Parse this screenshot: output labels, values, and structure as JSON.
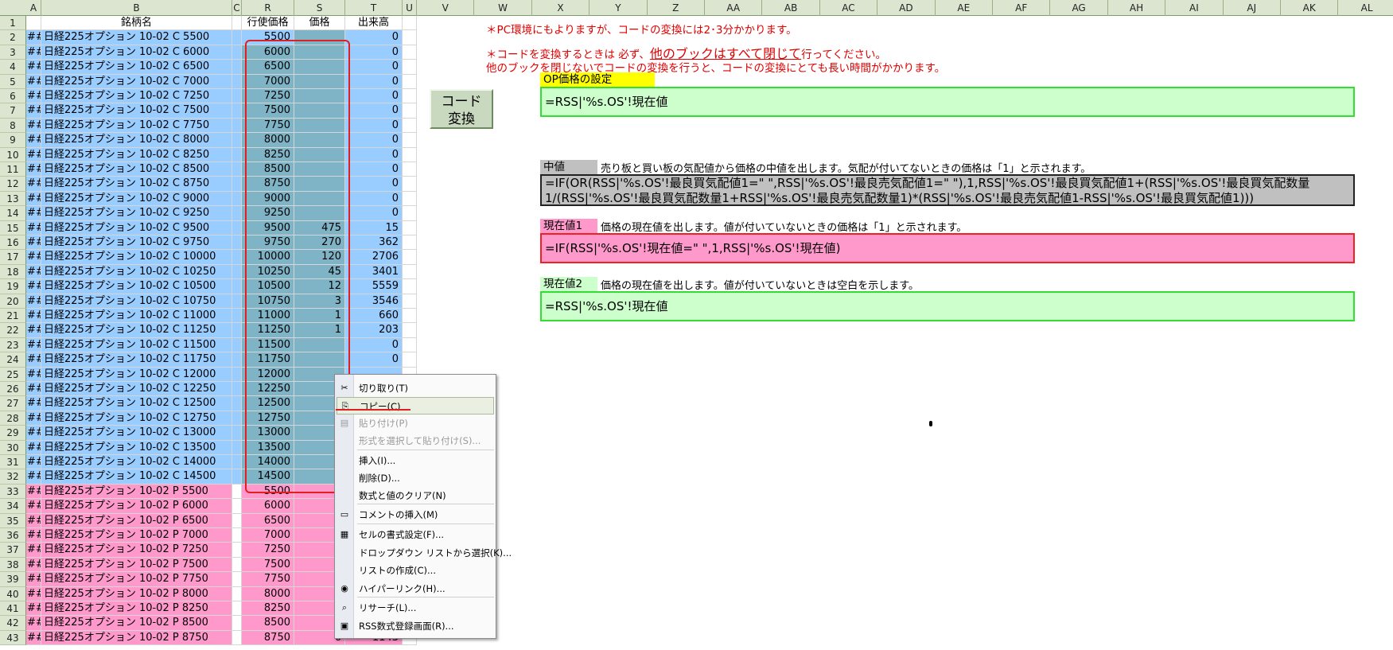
{
  "columns": [
    "A",
    "B",
    "C",
    "R",
    "S",
    "T",
    "U",
    "V",
    "W",
    "X",
    "Y",
    "Z",
    "AA",
    "AB",
    "AC",
    "AD",
    "AE",
    "AF",
    "AG",
    "AH",
    "AI",
    "AJ",
    "AK",
    "AL"
  ],
  "headers": {
    "a": "",
    "name": "銘柄名",
    "strike": "行使価格",
    "price": "価格",
    "volume": "出来高"
  },
  "rows": [
    {
      "a": "##",
      "name": "日経225オプション 10-02 C 5500",
      "strike": "5500",
      "price": "",
      "volume": "0"
    },
    {
      "a": "##",
      "name": "日経225オプション 10-02 C 6000",
      "strike": "6000",
      "price": "",
      "volume": "0"
    },
    {
      "a": "##",
      "name": "日経225オプション 10-02 C 6500",
      "strike": "6500",
      "price": "",
      "volume": "0"
    },
    {
      "a": "##",
      "name": "日経225オプション 10-02 C 7000",
      "strike": "7000",
      "price": "",
      "volume": "0"
    },
    {
      "a": "##",
      "name": "日経225オプション 10-02 C 7250",
      "strike": "7250",
      "price": "",
      "volume": "0"
    },
    {
      "a": "##",
      "name": "日経225オプション 10-02 C 7500",
      "strike": "7500",
      "price": "",
      "volume": "0"
    },
    {
      "a": "##",
      "name": "日経225オプション 10-02 C 7750",
      "strike": "7750",
      "price": "",
      "volume": "0"
    },
    {
      "a": "##",
      "name": "日経225オプション 10-02 C 8000",
      "strike": "8000",
      "price": "",
      "volume": "0"
    },
    {
      "a": "##",
      "name": "日経225オプション 10-02 C 8250",
      "strike": "8250",
      "price": "",
      "volume": "0"
    },
    {
      "a": "##",
      "name": "日経225オプション 10-02 C 8500",
      "strike": "8500",
      "price": "",
      "volume": "0"
    },
    {
      "a": "##",
      "name": "日経225オプション 10-02 C 8750",
      "strike": "8750",
      "price": "",
      "volume": "0"
    },
    {
      "a": "##",
      "name": "日経225オプション 10-02 C 9000",
      "strike": "9000",
      "price": "",
      "volume": "0"
    },
    {
      "a": "##",
      "name": "日経225オプション 10-02 C 9250",
      "strike": "9250",
      "price": "",
      "volume": "0"
    },
    {
      "a": "##",
      "name": "日経225オプション 10-02 C 9500",
      "strike": "9500",
      "price": "475",
      "volume": "15"
    },
    {
      "a": "##",
      "name": "日経225オプション 10-02 C 9750",
      "strike": "9750",
      "price": "270",
      "volume": "362"
    },
    {
      "a": "##",
      "name": "日経225オプション 10-02 C 10000",
      "strike": "10000",
      "price": "120",
      "volume": "2706"
    },
    {
      "a": "##",
      "name": "日経225オプション 10-02 C 10250",
      "strike": "10250",
      "price": "45",
      "volume": "3401"
    },
    {
      "a": "##",
      "name": "日経225オプション 10-02 C 10500",
      "strike": "10500",
      "price": "12",
      "volume": "5559"
    },
    {
      "a": "##",
      "name": "日経225オプション 10-02 C 10750",
      "strike": "10750",
      "price": "3",
      "volume": "3546"
    },
    {
      "a": "##",
      "name": "日経225オプション 10-02 C 11000",
      "strike": "11000",
      "price": "1",
      "volume": "660"
    },
    {
      "a": "##",
      "name": "日経225オプション 10-02 C 11250",
      "strike": "11250",
      "price": "1",
      "volume": "203"
    },
    {
      "a": "##",
      "name": "日経225オプション 10-02 C 11500",
      "strike": "11500",
      "price": "",
      "volume": "0"
    },
    {
      "a": "##",
      "name": "日経225オプション 10-02 C 11750",
      "strike": "11750",
      "price": "",
      "volume": "0"
    },
    {
      "a": "##",
      "name": "日経225オプション 10-02 C 12000",
      "strike": "12000",
      "price": "",
      "volume": ""
    },
    {
      "a": "##",
      "name": "日経225オプション 10-02 C 12250",
      "strike": "12250",
      "price": "",
      "volume": ""
    },
    {
      "a": "##",
      "name": "日経225オプション 10-02 C 12500",
      "strike": "12500",
      "price": "",
      "volume": ""
    },
    {
      "a": "##",
      "name": "日経225オプション 10-02 C 12750",
      "strike": "12750",
      "price": "",
      "volume": ""
    },
    {
      "a": "##",
      "name": "日経225オプション 10-02 C 13000",
      "strike": "13000",
      "price": "",
      "volume": ""
    },
    {
      "a": "##",
      "name": "日経225オプション 10-02 C 13500",
      "strike": "13500",
      "price": "",
      "volume": ""
    },
    {
      "a": "##",
      "name": "日経225オプション 10-02 C 14000",
      "strike": "14000",
      "price": "",
      "volume": ""
    },
    {
      "a": "##",
      "name": "日経225オプション 10-02 C 14500",
      "strike": "14500",
      "price": "",
      "volume": ""
    },
    {
      "a": "##",
      "name": "日経225オプション 10-02 P 5500",
      "strike": "5500",
      "price": "",
      "volume": ""
    },
    {
      "a": "##",
      "name": "日経225オプション 10-02 P 6000",
      "strike": "6000",
      "price": "",
      "volume": ""
    },
    {
      "a": "##",
      "name": "日経225オプション 10-02 P 6500",
      "strike": "6500",
      "price": "",
      "volume": ""
    },
    {
      "a": "##",
      "name": "日経225オプション 10-02 P 7000",
      "strike": "7000",
      "price": "",
      "volume": ""
    },
    {
      "a": "##",
      "name": "日経225オプション 10-02 P 7250",
      "strike": "7250",
      "price": "",
      "volume": ""
    },
    {
      "a": "##",
      "name": "日経225オプション 10-02 P 7500",
      "strike": "7500",
      "price": "",
      "volume": ""
    },
    {
      "a": "##",
      "name": "日経225オプション 10-02 P 7750",
      "strike": "7750",
      "price": "",
      "volume": ""
    },
    {
      "a": "##",
      "name": "日経225オプション 10-02 P 8000",
      "strike": "8000",
      "price": "",
      "volume": ""
    },
    {
      "a": "##",
      "name": "日経225オプション 10-02 P 8250",
      "strike": "8250",
      "price": "",
      "volume": ""
    },
    {
      "a": "##",
      "name": "日経225オプション 10-02 P 8500",
      "strike": "8500",
      "price": "",
      "volume": ""
    },
    {
      "a": "##",
      "name": "日経225オプション 10-02 P 8750",
      "strike": "8750",
      "price": "6",
      "volume": "1143"
    }
  ],
  "notes": {
    "note1": "＊PC環境にもよりますが、コードの変換には2･3分かかります。",
    "note2_prefix": "＊コードを変換するときは 必ず、",
    "note2_emph": "他のブックはすべて閉じて",
    "note2_suffix": "行ってください。",
    "note3": "他のブックを閉じないでコードの変換を行うと、コードの変換にとても長い時間がかかります。"
  },
  "op_setting": {
    "label": "OP価格の設定",
    "formula": "=RSS|'%s.OS'!現在値"
  },
  "convert_button": {
    "line1": "コード",
    "line2": "変換"
  },
  "mid": {
    "label": "中値",
    "desc": "売り板と買い板の気配値から価格の中値を出します。気配が付いてないときの価格は「1」と示されます。",
    "formula1": "=IF(OR(RSS|'%s.OS'!最良買気配値1=\" \",RSS|'%s.OS'!最良売気配値1=\" \"),1,RSS|'%s.OS'!最良買気配値1+(RSS|'%s.OS'!最良買気配数量",
    "formula2": "1/(RSS|'%s.OS'!最良買気配数量1+RSS|'%s.OS'!最良売気配数量1)*(RSS|'%s.OS'!最良売気配値1-RSS|'%s.OS'!最良買気配値1)))"
  },
  "current1": {
    "label": "現在値1",
    "desc": "価格の現在値を出します。値が付いていないときの価格は「1」と示されます。",
    "formula": "=IF(RSS|'%s.OS'!現在値=\" \",1,RSS|'%s.OS'!現在値)"
  },
  "current2": {
    "label": "現在値2",
    "desc": "価格の現在値を出します。値が付いていないときは空白を示します。",
    "formula": "=RSS|'%s.OS'!現在値"
  },
  "context_menu": [
    {
      "label": "切り取り(T)",
      "icon": "✂",
      "disabled": false,
      "highlight": false,
      "name": "cut"
    },
    {
      "label": "コピー(C)",
      "icon": "⎘",
      "disabled": false,
      "highlight": true,
      "name": "copy"
    },
    {
      "label": "貼り付け(P)",
      "icon": "▤",
      "disabled": true,
      "highlight": false,
      "name": "paste"
    },
    {
      "label": "形式を選択して貼り付け(S)...",
      "icon": "",
      "disabled": true,
      "highlight": false,
      "name": "paste-special"
    },
    {
      "label": "挿入(I)...",
      "icon": "",
      "disabled": false,
      "highlight": false,
      "name": "insert"
    },
    {
      "label": "削除(D)...",
      "icon": "",
      "disabled": false,
      "highlight": false,
      "name": "delete"
    },
    {
      "label": "数式と値のクリア(N)",
      "icon": "",
      "disabled": false,
      "highlight": false,
      "name": "clear-contents"
    },
    {
      "label": "コメントの挿入(M)",
      "icon": "▭",
      "disabled": false,
      "highlight": false,
      "name": "insert-comment"
    },
    {
      "label": "セルの書式設定(F)...",
      "icon": "▦",
      "disabled": false,
      "highlight": false,
      "name": "format-cells"
    },
    {
      "label": "ドロップダウン リストから選択(K)...",
      "icon": "",
      "disabled": false,
      "highlight": false,
      "name": "pick-from-list"
    },
    {
      "label": "リストの作成(C)...",
      "icon": "",
      "disabled": false,
      "highlight": false,
      "name": "create-list"
    },
    {
      "label": "ハイパーリンク(H)...",
      "icon": "◉",
      "disabled": false,
      "highlight": false,
      "name": "hyperlink"
    },
    {
      "label": "リサーチ(L)...",
      "icon": "⌕",
      "disabled": false,
      "highlight": false,
      "name": "research"
    },
    {
      "label": "RSS数式登録画面(R)...",
      "icon": "▣",
      "disabled": false,
      "highlight": false,
      "name": "rss-formula-register"
    }
  ],
  "colors": {
    "call_row": "#99ccff",
    "put_row": "#ff99cc",
    "selection": "#7fb3c6",
    "green_band": "#ccffcc",
    "pink_band": "#ff99cc",
    "gray_band": "#c0c0c0",
    "yellow_label": "#ffff00"
  }
}
